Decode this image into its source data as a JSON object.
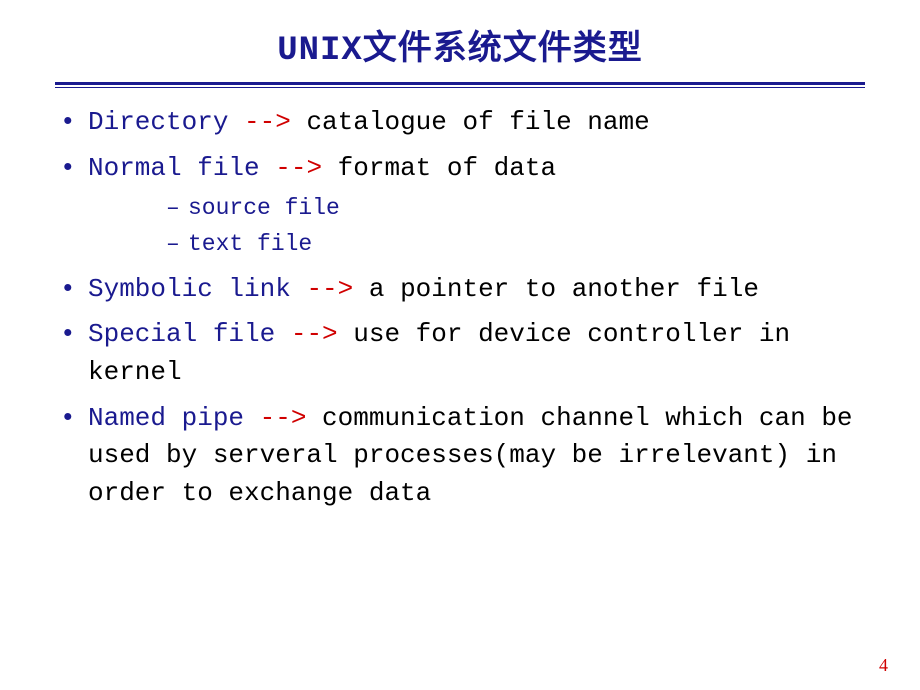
{
  "title": "UNIX文件系统文件类型",
  "items": [
    {
      "term": "Directory",
      "arrow": " --> ",
      "desc": "catalogue of file name",
      "subs": []
    },
    {
      "term": "Normal file",
      "arrow": " --> ",
      "desc": "format of data",
      "subs": [
        "source file",
        "text file"
      ]
    },
    {
      "term": "Symbolic link",
      "arrow": " --> ",
      "desc": "a pointer to another file",
      "subs": []
    },
    {
      "term": "Special file",
      "arrow": " --> ",
      "desc": "use for device controller in kernel",
      "subs": []
    },
    {
      "term": "Named pipe",
      "arrow": " --> ",
      "desc": "communication channel which can be used by serveral processes(may be  irrelevant)  in order to exchange data",
      "subs": []
    }
  ],
  "pageNumber": "4"
}
